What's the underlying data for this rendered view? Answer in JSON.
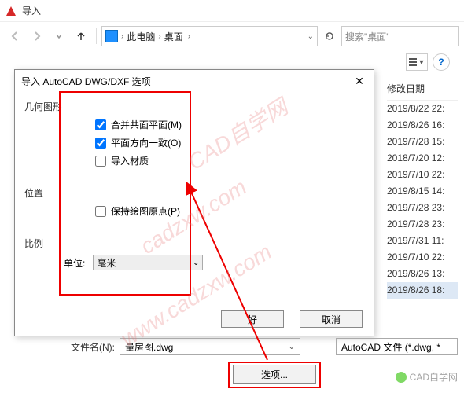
{
  "window": {
    "title": "导入"
  },
  "nav": {
    "path_loc": "此电脑",
    "path_folder": "桌面",
    "search_placeholder": "搜索\"桌面\""
  },
  "list": {
    "date_header": "修改日期",
    "dates": [
      "2019/8/22 22:",
      "2019/8/26 16:",
      "2019/7/28 15:",
      "2018/7/20 12:",
      "2019/7/10 22:",
      "2019/8/15 14:",
      "2019/7/28 23:",
      "2019/7/28 23:",
      "2019/7/31 11:",
      "2019/7/10 22:",
      "2019/8/26 13:",
      "2019/8/26 18:"
    ],
    "highlight_index": 11
  },
  "dialog": {
    "title": "导入 AutoCAD DWG/DXF 选项",
    "geom_label": "几何图形",
    "merge_faces": "合并共面平面(M)",
    "orient_faces": "平面方向一致(O)",
    "import_materials": "导入材质",
    "position_label": "位置",
    "preserve_origin": "保持绘图原点(P)",
    "scale_label": "比例",
    "unit_label": "单位:",
    "unit_value": "毫米",
    "ok": "好",
    "cancel": "取消"
  },
  "file": {
    "name_label": "文件名(N):",
    "name_value": "量房图.dwg",
    "type_value": "AutoCAD 文件 (*.dwg, *",
    "options_label": "选项..."
  },
  "watermark": {
    "t1": "CAD自学网",
    "t2": "cadzxw.com",
    "t3": "www.cadzxw.com"
  },
  "badge": {
    "text": "CAD自学网"
  }
}
